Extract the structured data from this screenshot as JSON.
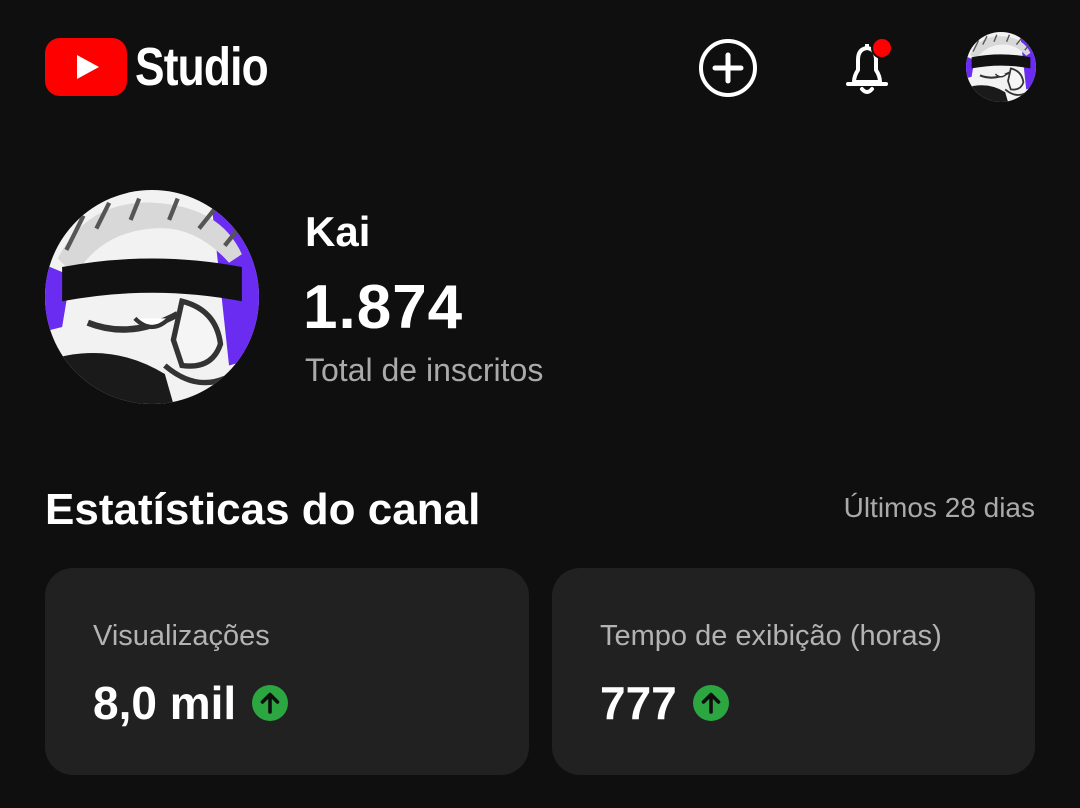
{
  "header": {
    "brand": "Studio",
    "icons": [
      "youtube-logo-icon",
      "create-plus-icon",
      "notification-bell-icon",
      "account-avatar"
    ],
    "notification_dot": true,
    "colors": {
      "brand_red": "#ff0000",
      "notification_dot": "#ff0000",
      "avatar_purple": "#6a2cf0"
    }
  },
  "channel": {
    "name": "Kai",
    "subscriber_count": "1.874",
    "subscriber_label": "Total de inscritos"
  },
  "stats": {
    "title": "Estatísticas do canal",
    "period": "Últimos 28 dias",
    "cards": [
      {
        "label": "Visualizações",
        "value": "8,0 mil",
        "trend": "up"
      },
      {
        "label": "Tempo de exibição (horas)",
        "value": "777",
        "trend": "up"
      }
    ],
    "colors": {
      "trend_up": "#2ba640",
      "card_bg": "#212121"
    }
  }
}
